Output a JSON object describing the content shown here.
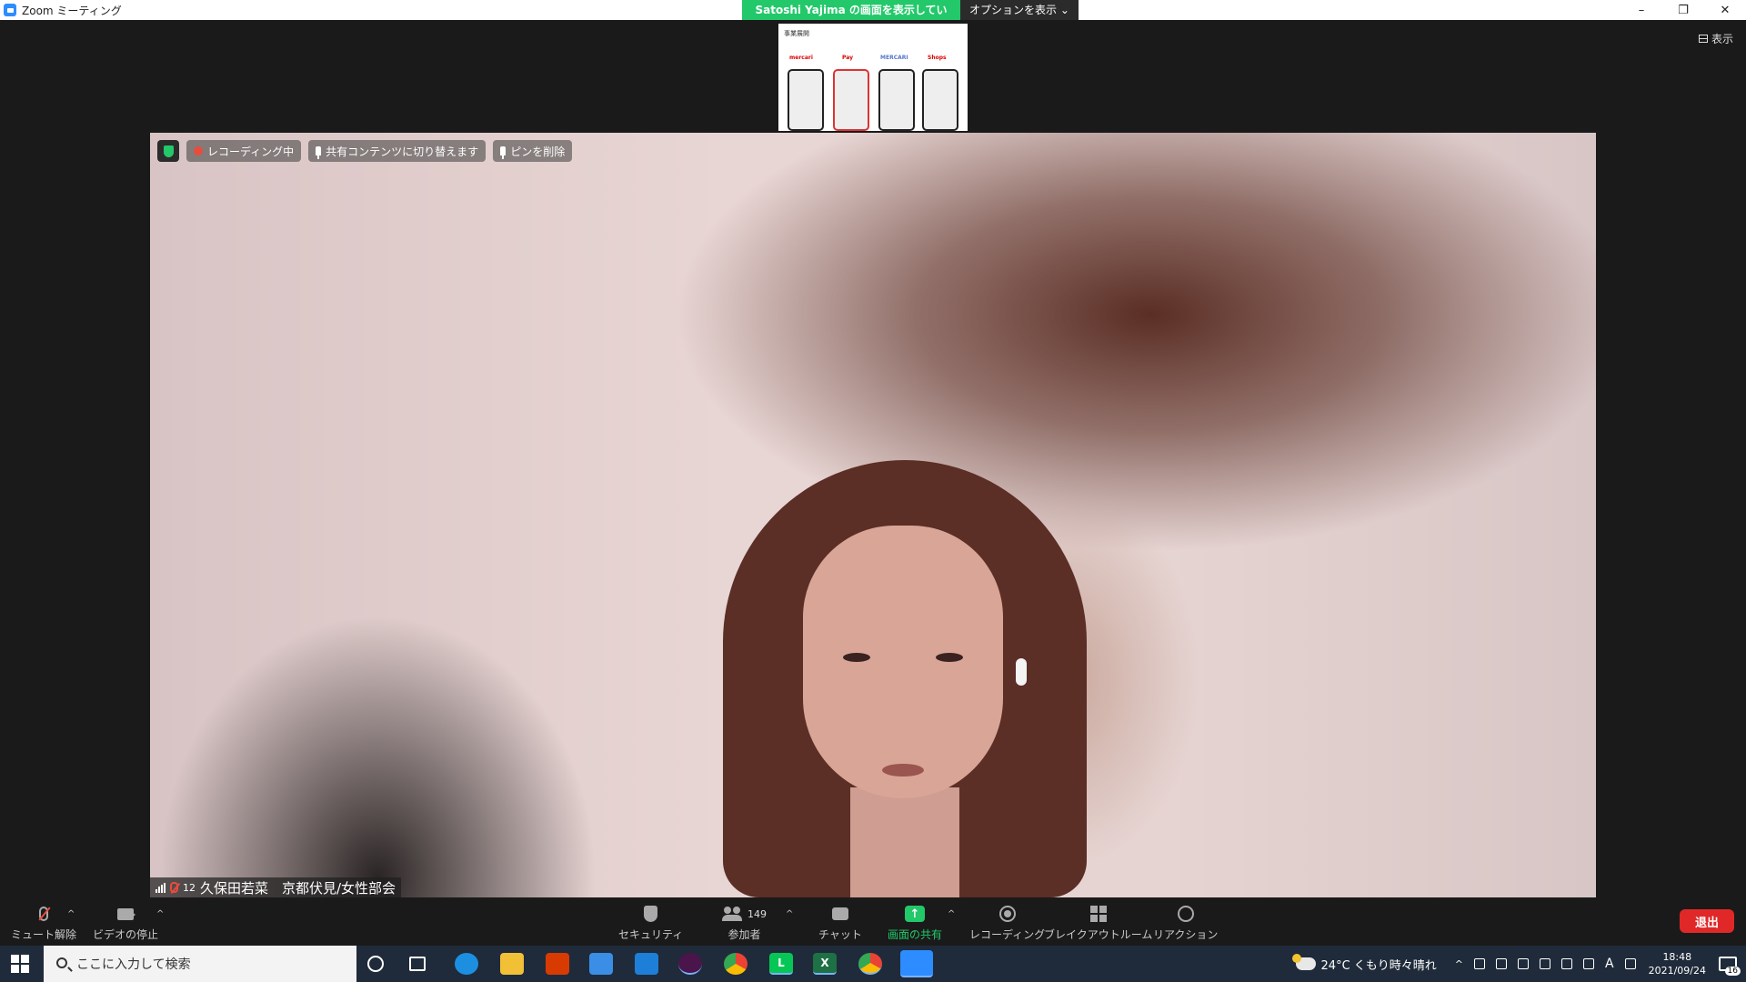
{
  "window": {
    "title": "Zoom ミーティング",
    "share_banner": "Satoshi  Yajima の画面を表示しています",
    "share_options": "オプションを表示",
    "controls": [
      "–",
      "❐",
      "✕"
    ]
  },
  "stage": {
    "view_label": "表示",
    "thumbnail": {
      "heading": "事業展開",
      "brands": [
        "mercari",
        "Pay",
        "MERCARI",
        "Shops"
      ]
    }
  },
  "video": {
    "recording_label": "レコーディング中",
    "switch_shared_label": "共有コンテンツに切り替えます",
    "unpin_label": "ピンを削除",
    "participant_count": "12",
    "participant_name": "久保田若菜　京都伏見/女性部会"
  },
  "toolbar": {
    "unmute": "ミュート解除",
    "stop_video": "ビデオの停止",
    "security": "セキュリティ",
    "participants": "参加者",
    "participants_count": "149",
    "chat": "チャット",
    "share_screen": "画面の共有",
    "recording": "レコーディング",
    "breakout": "ブレイクアウトルーム",
    "reactions": "リアクション",
    "leave": "退出"
  },
  "taskbar": {
    "search_placeholder": "ここに入力して検索",
    "apps": [
      "cortana",
      "task-view",
      "edge",
      "explorer",
      "office",
      "store",
      "mail",
      "slack",
      "chrome",
      "line",
      "excel",
      "chrome-2",
      "zoom"
    ],
    "weather": "24°C  くもり時々晴れ",
    "time": "18:48",
    "date": "2021/09/24",
    "notifications": "16",
    "ime": "A"
  },
  "colors": {
    "accent_green": "#23c86a",
    "leave_red": "#e02828",
    "zoom_blue": "#2d8cff"
  }
}
